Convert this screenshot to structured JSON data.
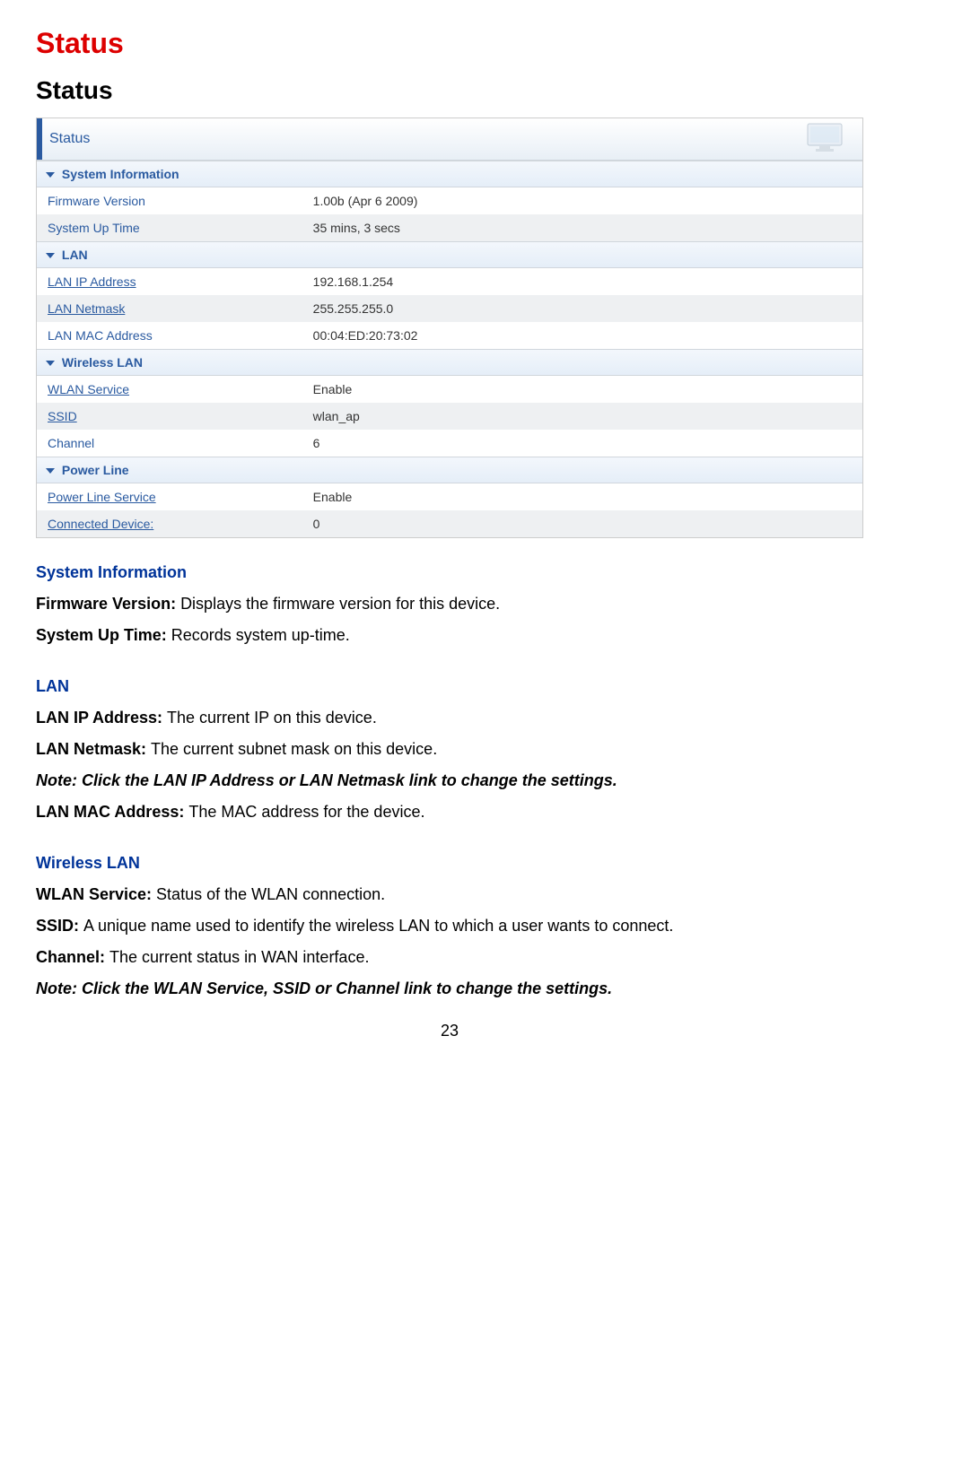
{
  "title": "Status",
  "subtitle": "Status",
  "panel": {
    "tab": "Status",
    "sections": [
      {
        "title": "System Information",
        "rows": [
          {
            "label": "Firmware Version",
            "value": "1.00b (Apr 6 2009)",
            "link": false,
            "alt": false
          },
          {
            "label": "System Up Time",
            "value": "35 mins, 3 secs",
            "link": false,
            "alt": true
          }
        ]
      },
      {
        "title": "LAN",
        "rows": [
          {
            "label": "LAN IP Address",
            "value": "192.168.1.254",
            "link": true,
            "alt": false
          },
          {
            "label": "LAN Netmask",
            "value": "255.255.255.0",
            "link": true,
            "alt": true
          },
          {
            "label": "LAN MAC Address",
            "value": "00:04:ED:20:73:02",
            "link": false,
            "alt": false
          }
        ]
      },
      {
        "title": "Wireless LAN",
        "rows": [
          {
            "label": "WLAN Service",
            "value": "Enable",
            "link": true,
            "alt": false
          },
          {
            "label": "SSID",
            "value": "wlan_ap",
            "link": true,
            "alt": true
          },
          {
            "label": "Channel",
            "value": "6",
            "link": false,
            "alt": false
          }
        ]
      },
      {
        "title": "Power Line",
        "rows": [
          {
            "label": "Power Line Service",
            "value": "Enable",
            "link": true,
            "alt": false
          },
          {
            "label": "Connected Device:",
            "value": "0",
            "link": true,
            "alt": true
          }
        ]
      }
    ]
  },
  "descriptions": {
    "sysinfo": {
      "heading": "System Information",
      "firmware_b": "Firmware Version: ",
      "firmware_t": "Displays the firmware version for this device.",
      "uptime_b": "System Up Time: ",
      "uptime_t": "Records system up-time."
    },
    "lan": {
      "heading": "LAN",
      "ip_b": "LAN IP Address: ",
      "ip_t": "The current IP on this device.",
      "nm_b": "LAN Netmask: ",
      "nm_t": "The current subnet mask on this device.",
      "note": "Note: Click the LAN IP Address or LAN Netmask link to change the settings.",
      "mac_b": "LAN MAC Address: ",
      "mac_t": "The MAC address for the device."
    },
    "wlan": {
      "heading": "Wireless LAN",
      "svc_b": "WLAN Service: ",
      "svc_t": "Status of the WLAN connection.",
      "ssid_b": "SSID: ",
      "ssid_t": "A unique name used to identify the wireless LAN to which a user wants to connect.",
      "ch_b": "Channel: ",
      "ch_t": "The current status in WAN interface.",
      "note": "Note: Click the WLAN Service, SSID or  Channel link to change the settings."
    }
  },
  "page_number": "23"
}
